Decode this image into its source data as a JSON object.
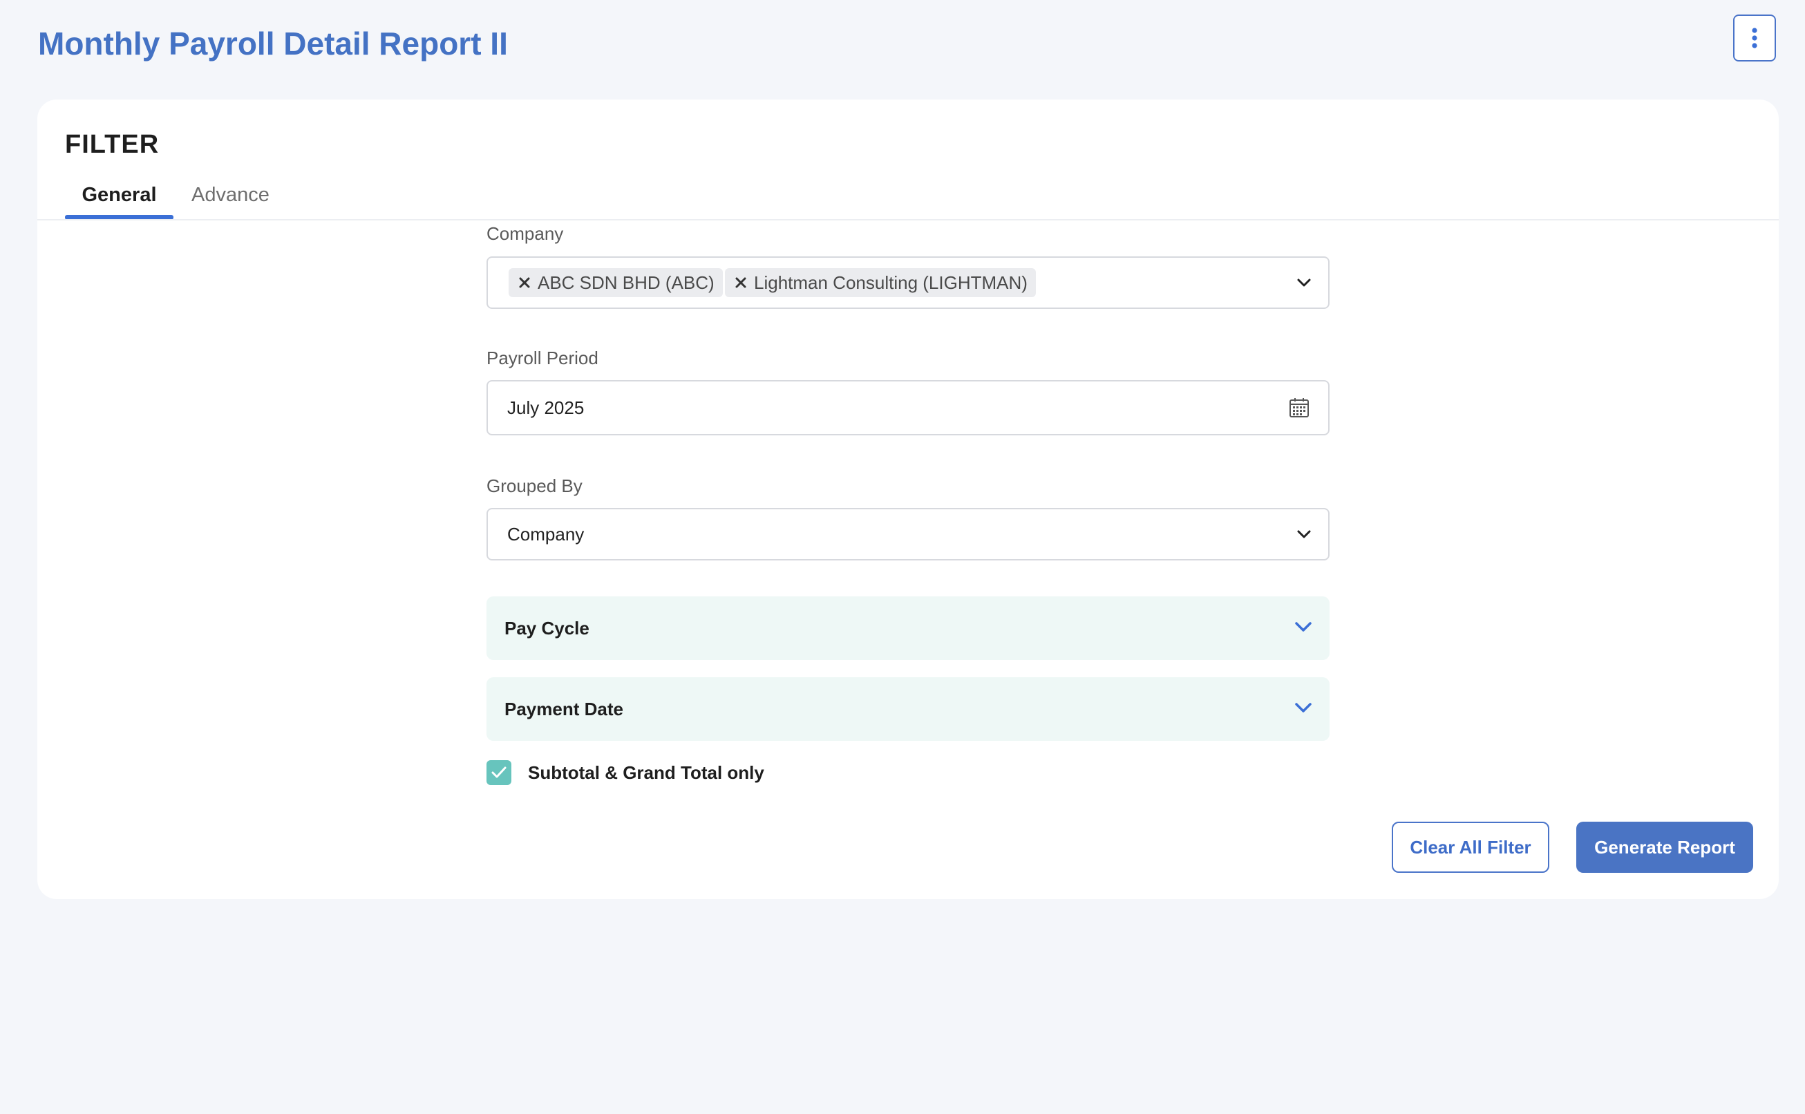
{
  "page": {
    "title": "Monthly Payroll Detail Report II"
  },
  "filter": {
    "heading": "FILTER",
    "tabs": [
      {
        "label": "General",
        "active": true
      },
      {
        "label": "Advance",
        "active": false
      }
    ]
  },
  "fields": {
    "company": {
      "label": "Company",
      "selected": [
        "ABC SDN BHD (ABC)",
        "Lightman Consulting (LIGHTMAN)"
      ]
    },
    "payroll_period": {
      "label": "Payroll Period",
      "value": "July 2025"
    },
    "grouped_by": {
      "label": "Grouped By",
      "value": "Company"
    }
  },
  "accordions": {
    "pay_cycle": "Pay Cycle",
    "payment_date": "Payment Date"
  },
  "options": {
    "subtotal_only": {
      "label": "Subtotal & Grand Total only",
      "checked": true
    }
  },
  "actions": {
    "clear": "Clear All Filter",
    "generate": "Generate Report"
  },
  "icons": {
    "menu": "kebab-menu-icon",
    "remove": "close-icon",
    "dropdown": "chevron-down-icon",
    "calendar": "calendar-icon",
    "check": "check-icon"
  },
  "colors": {
    "accent": "#4472c4",
    "accordion_bg": "#eef8f6",
    "checkbox": "#67c4bd",
    "page_bg": "#f4f6fa"
  }
}
